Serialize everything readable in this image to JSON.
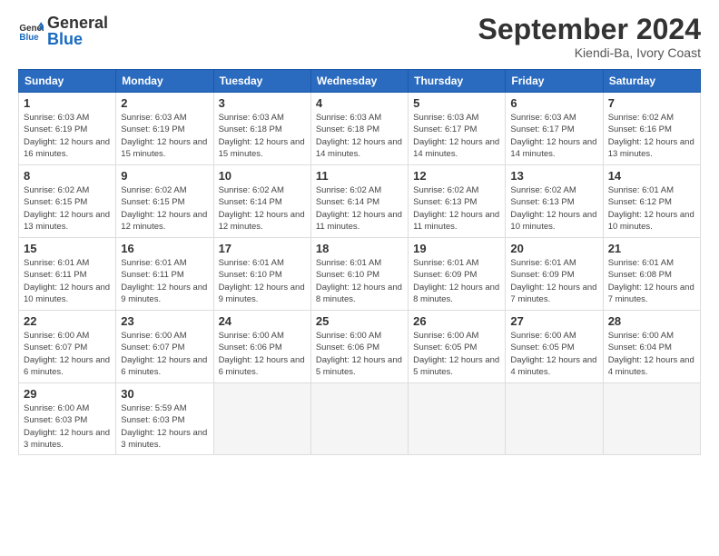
{
  "header": {
    "logo_general": "General",
    "logo_blue": "Blue",
    "month_title": "September 2024",
    "location": "Kiendi-Ba, Ivory Coast"
  },
  "columns": [
    "Sunday",
    "Monday",
    "Tuesday",
    "Wednesday",
    "Thursday",
    "Friday",
    "Saturday"
  ],
  "weeks": [
    [
      {
        "day": "1",
        "sunrise": "Sunrise: 6:03 AM",
        "sunset": "Sunset: 6:19 PM",
        "daylight": "Daylight: 12 hours and 16 minutes."
      },
      {
        "day": "2",
        "sunrise": "Sunrise: 6:03 AM",
        "sunset": "Sunset: 6:19 PM",
        "daylight": "Daylight: 12 hours and 15 minutes."
      },
      {
        "day": "3",
        "sunrise": "Sunrise: 6:03 AM",
        "sunset": "Sunset: 6:18 PM",
        "daylight": "Daylight: 12 hours and 15 minutes."
      },
      {
        "day": "4",
        "sunrise": "Sunrise: 6:03 AM",
        "sunset": "Sunset: 6:18 PM",
        "daylight": "Daylight: 12 hours and 14 minutes."
      },
      {
        "day": "5",
        "sunrise": "Sunrise: 6:03 AM",
        "sunset": "Sunset: 6:17 PM",
        "daylight": "Daylight: 12 hours and 14 minutes."
      },
      {
        "day": "6",
        "sunrise": "Sunrise: 6:03 AM",
        "sunset": "Sunset: 6:17 PM",
        "daylight": "Daylight: 12 hours and 14 minutes."
      },
      {
        "day": "7",
        "sunrise": "Sunrise: 6:02 AM",
        "sunset": "Sunset: 6:16 PM",
        "daylight": "Daylight: 12 hours and 13 minutes."
      }
    ],
    [
      {
        "day": "8",
        "sunrise": "Sunrise: 6:02 AM",
        "sunset": "Sunset: 6:15 PM",
        "daylight": "Daylight: 12 hours and 13 minutes."
      },
      {
        "day": "9",
        "sunrise": "Sunrise: 6:02 AM",
        "sunset": "Sunset: 6:15 PM",
        "daylight": "Daylight: 12 hours and 12 minutes."
      },
      {
        "day": "10",
        "sunrise": "Sunrise: 6:02 AM",
        "sunset": "Sunset: 6:14 PM",
        "daylight": "Daylight: 12 hours and 12 minutes."
      },
      {
        "day": "11",
        "sunrise": "Sunrise: 6:02 AM",
        "sunset": "Sunset: 6:14 PM",
        "daylight": "Daylight: 12 hours and 11 minutes."
      },
      {
        "day": "12",
        "sunrise": "Sunrise: 6:02 AM",
        "sunset": "Sunset: 6:13 PM",
        "daylight": "Daylight: 12 hours and 11 minutes."
      },
      {
        "day": "13",
        "sunrise": "Sunrise: 6:02 AM",
        "sunset": "Sunset: 6:13 PM",
        "daylight": "Daylight: 12 hours and 10 minutes."
      },
      {
        "day": "14",
        "sunrise": "Sunrise: 6:01 AM",
        "sunset": "Sunset: 6:12 PM",
        "daylight": "Daylight: 12 hours and 10 minutes."
      }
    ],
    [
      {
        "day": "15",
        "sunrise": "Sunrise: 6:01 AM",
        "sunset": "Sunset: 6:11 PM",
        "daylight": "Daylight: 12 hours and 10 minutes."
      },
      {
        "day": "16",
        "sunrise": "Sunrise: 6:01 AM",
        "sunset": "Sunset: 6:11 PM",
        "daylight": "Daylight: 12 hours and 9 minutes."
      },
      {
        "day": "17",
        "sunrise": "Sunrise: 6:01 AM",
        "sunset": "Sunset: 6:10 PM",
        "daylight": "Daylight: 12 hours and 9 minutes."
      },
      {
        "day": "18",
        "sunrise": "Sunrise: 6:01 AM",
        "sunset": "Sunset: 6:10 PM",
        "daylight": "Daylight: 12 hours and 8 minutes."
      },
      {
        "day": "19",
        "sunrise": "Sunrise: 6:01 AM",
        "sunset": "Sunset: 6:09 PM",
        "daylight": "Daylight: 12 hours and 8 minutes."
      },
      {
        "day": "20",
        "sunrise": "Sunrise: 6:01 AM",
        "sunset": "Sunset: 6:09 PM",
        "daylight": "Daylight: 12 hours and 7 minutes."
      },
      {
        "day": "21",
        "sunrise": "Sunrise: 6:01 AM",
        "sunset": "Sunset: 6:08 PM",
        "daylight": "Daylight: 12 hours and 7 minutes."
      }
    ],
    [
      {
        "day": "22",
        "sunrise": "Sunrise: 6:00 AM",
        "sunset": "Sunset: 6:07 PM",
        "daylight": "Daylight: 12 hours and 6 minutes."
      },
      {
        "day": "23",
        "sunrise": "Sunrise: 6:00 AM",
        "sunset": "Sunset: 6:07 PM",
        "daylight": "Daylight: 12 hours and 6 minutes."
      },
      {
        "day": "24",
        "sunrise": "Sunrise: 6:00 AM",
        "sunset": "Sunset: 6:06 PM",
        "daylight": "Daylight: 12 hours and 6 minutes."
      },
      {
        "day": "25",
        "sunrise": "Sunrise: 6:00 AM",
        "sunset": "Sunset: 6:06 PM",
        "daylight": "Daylight: 12 hours and 5 minutes."
      },
      {
        "day": "26",
        "sunrise": "Sunrise: 6:00 AM",
        "sunset": "Sunset: 6:05 PM",
        "daylight": "Daylight: 12 hours and 5 minutes."
      },
      {
        "day": "27",
        "sunrise": "Sunrise: 6:00 AM",
        "sunset": "Sunset: 6:05 PM",
        "daylight": "Daylight: 12 hours and 4 minutes."
      },
      {
        "day": "28",
        "sunrise": "Sunrise: 6:00 AM",
        "sunset": "Sunset: 6:04 PM",
        "daylight": "Daylight: 12 hours and 4 minutes."
      }
    ],
    [
      {
        "day": "29",
        "sunrise": "Sunrise: 6:00 AM",
        "sunset": "Sunset: 6:03 PM",
        "daylight": "Daylight: 12 hours and 3 minutes."
      },
      {
        "day": "30",
        "sunrise": "Sunrise: 5:59 AM",
        "sunset": "Sunset: 6:03 PM",
        "daylight": "Daylight: 12 hours and 3 minutes."
      },
      null,
      null,
      null,
      null,
      null
    ]
  ]
}
